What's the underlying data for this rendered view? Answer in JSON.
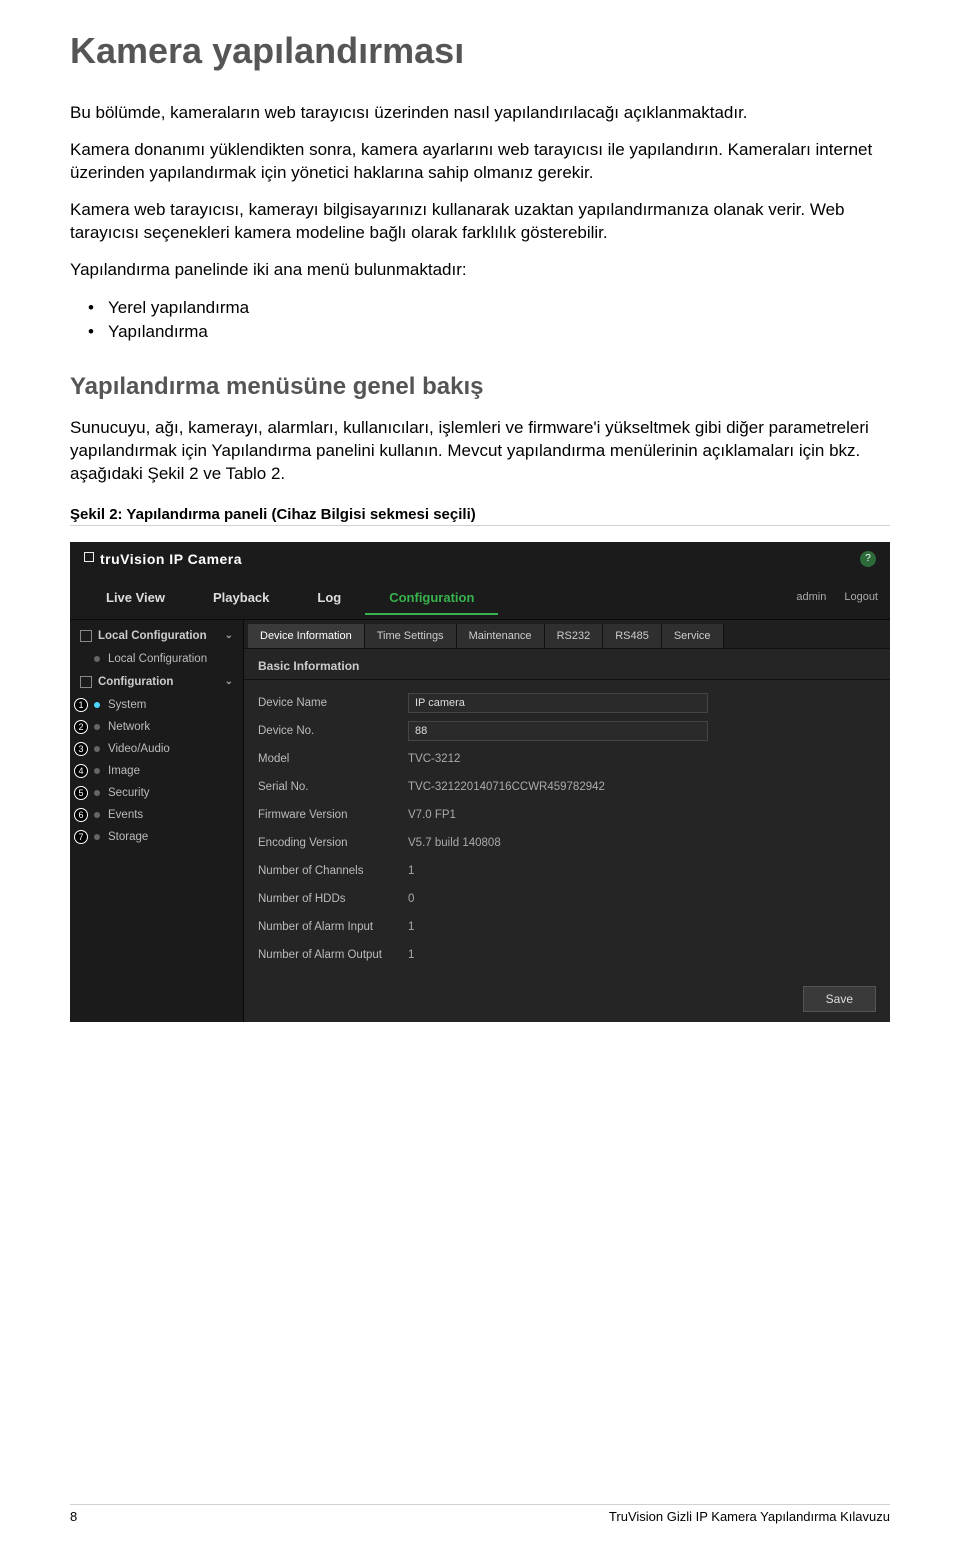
{
  "doc": {
    "h1": "Kamera yapılandırması",
    "p1": "Bu bölümde, kameraların web tarayıcısı üzerinden nasıl yapılandırılacağı açıklanmaktadır.",
    "p2": "Kamera donanımı yüklendikten sonra, kamera ayarlarını web tarayıcısı ile yapılandırın. Kameraları internet üzerinden yapılandırmak için yönetici haklarına sahip olmanız gerekir.",
    "p3": "Kamera web tarayıcısı, kamerayı bilgisayarınızı kullanarak uzaktan yapılandırmanıza olanak verir. Web tarayıcısı seçenekleri kamera modeline bağlı olarak farklılık gösterebilir.",
    "p4": "Yapılandırma panelinde iki ana menü bulunmaktadır:",
    "li1": "Yerel yapılandırma",
    "li2": "Yapılandırma",
    "h2": "Yapılandırma menüsüne genel bakış",
    "p5": "Sunucuyu, ağı, kamerayı, alarmları, kullanıcıları, işlemleri ve firmware'i yükseltmek gibi diğer parametreleri yapılandırmak için Yapılandırma panelini kullanın. Mevcut yapılandırma menülerinin açıklamaları için bkz. aşağıdaki Şekil 2 ve Tablo 2.",
    "figcap": "Şekil 2: Yapılandırma paneli (Cihaz Bilgisi sekmesi seçili)"
  },
  "shot": {
    "brand": "truVision IP Camera",
    "help": "?",
    "nav": {
      "live": "Live View",
      "playback": "Playback",
      "log": "Log",
      "config": "Configuration",
      "user": "admin",
      "logout": "Logout"
    },
    "side": {
      "local_h": "Local Configuration",
      "local_item": "Local Configuration",
      "conf_h": "Configuration",
      "items": [
        {
          "n": "1",
          "label": "System"
        },
        {
          "n": "2",
          "label": "Network"
        },
        {
          "n": "3",
          "label": "Video/Audio"
        },
        {
          "n": "4",
          "label": "Image"
        },
        {
          "n": "5",
          "label": "Security"
        },
        {
          "n": "6",
          "label": "Events"
        },
        {
          "n": "7",
          "label": "Storage"
        }
      ]
    },
    "tabs": {
      "t0": "Device Information",
      "t1": "Time Settings",
      "t2": "Maintenance",
      "t3": "RS232",
      "t4": "RS485",
      "t5": "Service"
    },
    "section": "Basic Information",
    "form": {
      "device_name_lbl": "Device Name",
      "device_name_val": "IP camera",
      "device_no_lbl": "Device No.",
      "device_no_val": "88",
      "model_lbl": "Model",
      "model_val": "TVC-3212",
      "serial_lbl": "Serial No.",
      "serial_val": "TVC-321220140716CCWR459782942",
      "fw_lbl": "Firmware Version",
      "fw_val": "V7.0 FP1",
      "enc_lbl": "Encoding Version",
      "enc_val": "V5.7 build 140808",
      "ch_lbl": "Number of Channels",
      "ch_val": "1",
      "hdd_lbl": "Number of HDDs",
      "hdd_val": "0",
      "ain_lbl": "Number of Alarm Input",
      "ain_val": "1",
      "aout_lbl": "Number of Alarm Output",
      "aout_val": "1"
    },
    "save": "Save"
  },
  "footer": {
    "page": "8",
    "title": "TruVision Gizli IP Kamera Yapılandırma Kılavuzu"
  }
}
